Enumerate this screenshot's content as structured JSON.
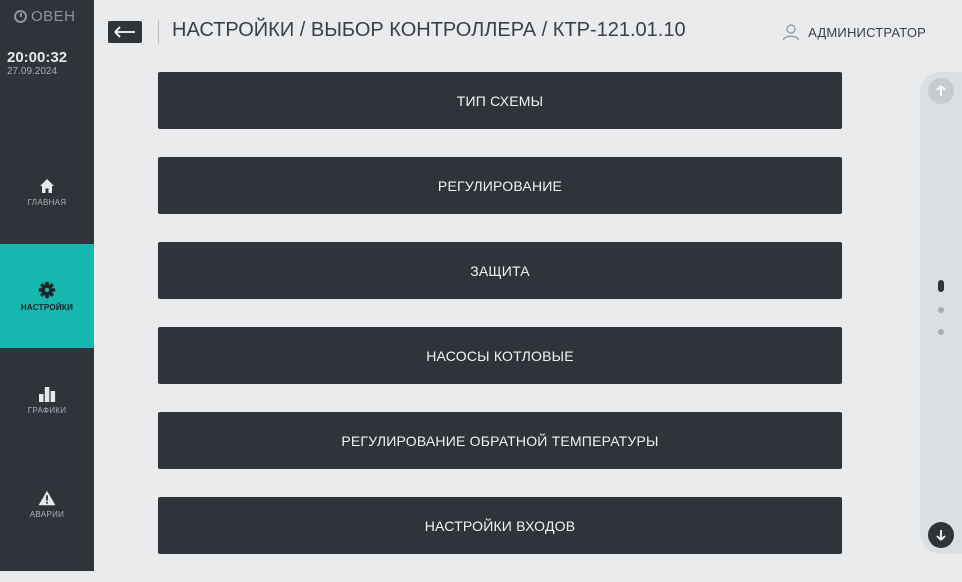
{
  "brand": {
    "logo_text": "ОВЕН",
    "icon": "clock-icon"
  },
  "clock": {
    "time": "20:00:32",
    "date": "27.09.2024"
  },
  "sidebar": {
    "items": [
      {
        "label": "ГЛАВНАЯ",
        "icon": "home-icon",
        "active": false
      },
      {
        "label": "НАСТРОЙКИ",
        "icon": "gear-icon",
        "active": true
      },
      {
        "label": "ГРАФИКИ",
        "icon": "bar-chart-icon",
        "active": false
      },
      {
        "label": "АВАРИИ",
        "icon": "warning-icon",
        "active": false
      }
    ]
  },
  "header": {
    "back_icon": "arrow-left-icon",
    "title": "НАСТРОЙКИ / ВЫБОР КОНТРОЛЛЕРА / КТР-121.01.10",
    "user_icon": "user-icon",
    "user_name": "АДМИНИСТРАТОР"
  },
  "menu": {
    "items": [
      "ТИП СХЕМЫ",
      "РЕГУЛИРОВАНИЕ",
      "ЗАЩИТА",
      "НАСОСЫ КОТЛОВЫЕ",
      "РЕГУЛИРОВАНИЕ ОБРАТНОЙ ТЕМПЕРАТУРЫ",
      "НАСТРОЙКИ ВХОДОВ"
    ]
  },
  "scroll": {
    "page_count": 3,
    "current_page": 1,
    "up_icon": "arrow-up-icon",
    "down_icon": "arrow-down-icon"
  },
  "colors": {
    "sidebar_bg": "#2f343a",
    "accent": "#15b7ae",
    "button_bg": "#2f343a",
    "page_bg": "#e9ebed"
  }
}
